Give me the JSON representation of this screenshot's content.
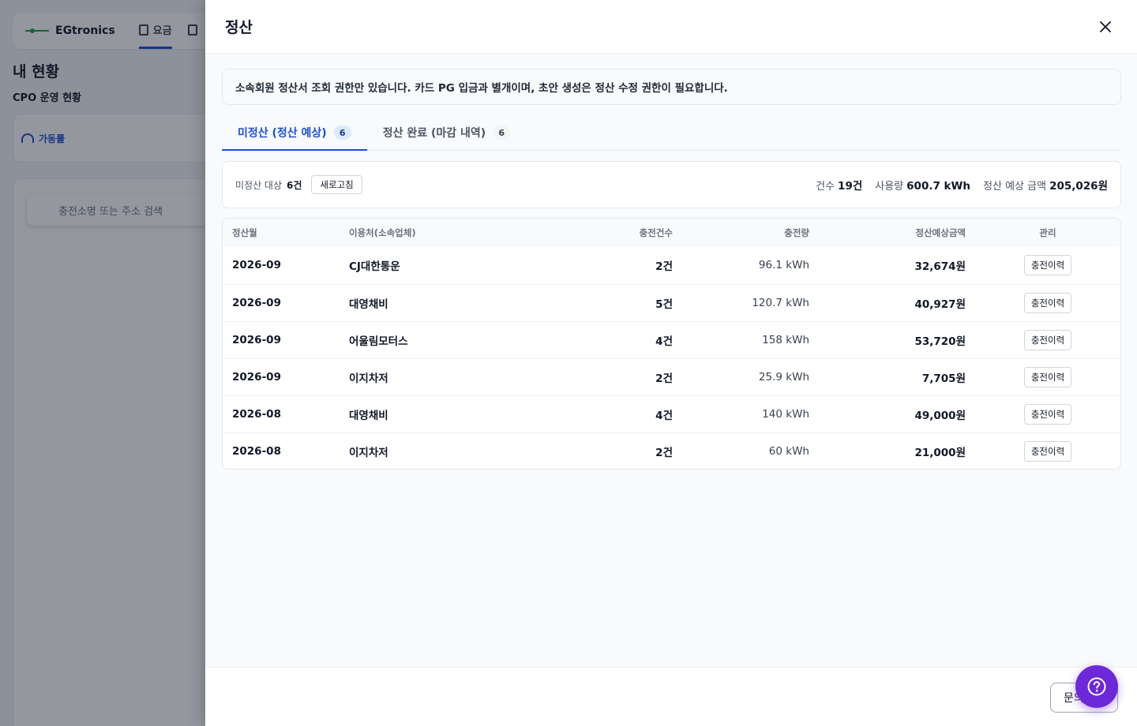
{
  "background": {
    "logo_text": "EGtronics",
    "nav": [
      {
        "label": "요금"
      },
      {
        "label": ""
      }
    ],
    "title": "내 현황",
    "subtitle": "CPO 운영 현황",
    "card_label": "가동률",
    "search_placeholder": "충전소명 또는 주소 검색"
  },
  "drawer": {
    "title": "정산",
    "close_icon": "close-icon",
    "notice": "소속회원 정산서 조회 권한만 있습니다. 카드 PG 입금과 별개이며, 초안 생성은 정산 수정 권한이 필요합니다.",
    "tabs": [
      {
        "label": "미정산 (정산 예상)",
        "count": "6",
        "active": true
      },
      {
        "label": "정산 완료 (마감 내역)",
        "count": "6",
        "active": false
      }
    ],
    "summary": {
      "target_label": "미정산 대상",
      "target_count": "6건",
      "refresh_label": "새로고침",
      "count_label": "건수",
      "count_value": "19건",
      "usage_label": "사용량",
      "usage_value": "600.7 kWh",
      "amount_label": "정산 예상 금액",
      "amount_value": "205,026원"
    },
    "table": {
      "headers": [
        "정산월",
        "이용처(소속업체)",
        "충전건수",
        "충전량",
        "정산예상금액",
        "관리"
      ],
      "rows": [
        {
          "month": "2026-09",
          "user": "CJ대한통운",
          "count": "2건",
          "amount": "96.1 kWh",
          "money": "32,674원",
          "action": "충전이력"
        },
        {
          "month": "2026-09",
          "user": "대영채비",
          "count": "5건",
          "amount": "120.7 kWh",
          "money": "40,927원",
          "action": "충전이력"
        },
        {
          "month": "2026-09",
          "user": "어울림모터스",
          "count": "4건",
          "amount": "158 kWh",
          "money": "53,720원",
          "action": "충전이력"
        },
        {
          "month": "2026-09",
          "user": "이지차저",
          "count": "2건",
          "amount": "25.9 kWh",
          "money": "7,705원",
          "action": "충전이력"
        },
        {
          "month": "2026-08",
          "user": "대영채비",
          "count": "4건",
          "amount": "140 kWh",
          "money": "49,000원",
          "action": "충전이력"
        },
        {
          "month": "2026-08",
          "user": "이지차저",
          "count": "2건",
          "amount": "60 kWh",
          "money": "21,000원",
          "action": "충전이력"
        }
      ]
    },
    "footer": {
      "inquiry_label": "문의",
      "help_icon": "help-icon"
    }
  },
  "colors": {
    "accent": "#1d4ed8",
    "help_fab": "#6d28d9"
  }
}
